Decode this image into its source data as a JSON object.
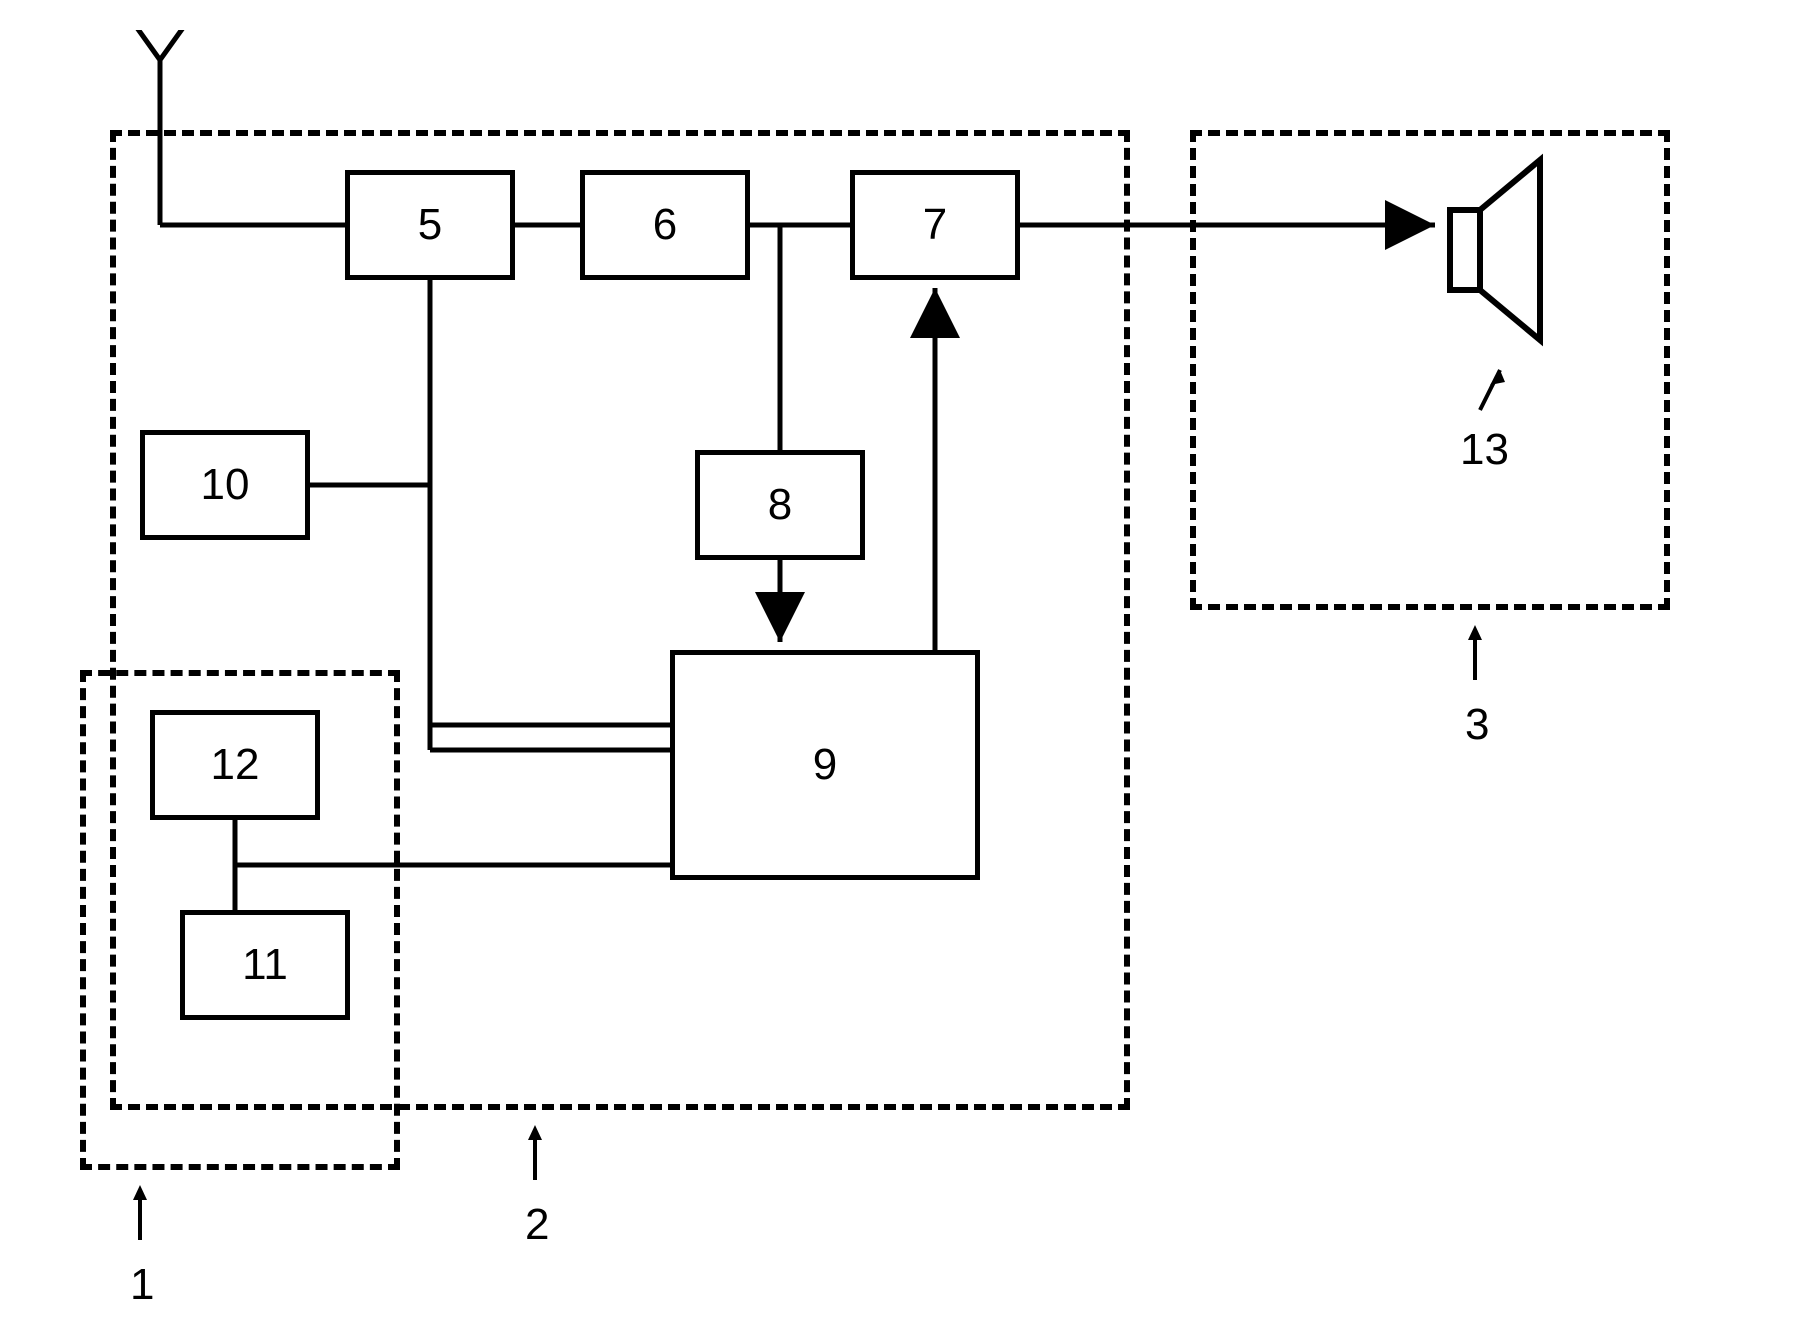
{
  "diagram": {
    "blocks": {
      "b5": "5",
      "b6": "6",
      "b7": "7",
      "b8": "8",
      "b9": "9",
      "b10": "10",
      "b11": "11",
      "b12": "12"
    },
    "region_labels": {
      "r1": "1",
      "r2": "2",
      "r3": "3"
    },
    "element_labels": {
      "speaker": "13"
    }
  }
}
